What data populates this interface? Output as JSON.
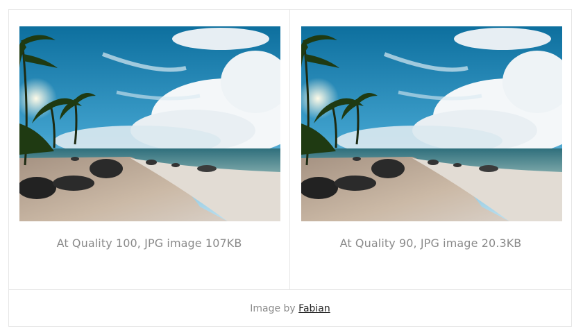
{
  "images": [
    {
      "caption": "At Quality 100, JPG image 107KB",
      "icon": "beach-photo"
    },
    {
      "caption": "At Quality 90, JPG image 20.3KB",
      "icon": "beach-photo"
    }
  ],
  "credit": {
    "prefix": "Image by ",
    "author": "Fabian"
  },
  "colors": {
    "border": "#e6e6e6",
    "caption_text": "#8a8a8a",
    "link_text": "#222222",
    "sky": "#1f86b8",
    "sand": "#c9b9a7"
  }
}
